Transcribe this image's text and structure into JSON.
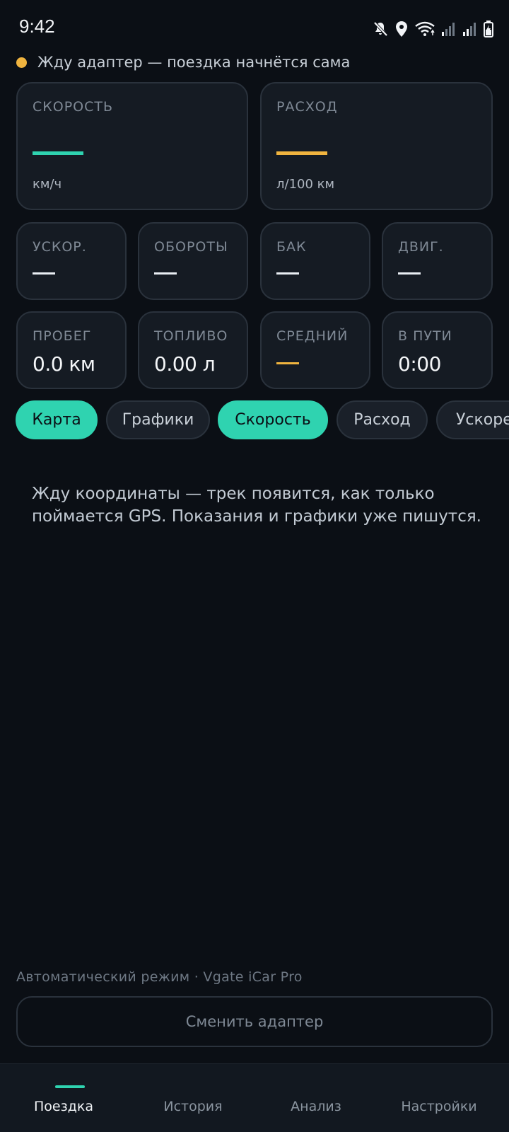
{
  "status_bar": {
    "time": "9:42",
    "icons": [
      "mute-icon",
      "location-icon",
      "wifi-icon",
      "signal-icon",
      "signal-icon",
      "battery-charging-icon"
    ]
  },
  "adapter_status": {
    "text": "Жду адаптер — поездка начнётся сама",
    "dot_color": "#f0b43f"
  },
  "big_cards": [
    {
      "label": "СКОРОСТЬ",
      "unit": "км/ч",
      "accent": "#2fd3b0"
    },
    {
      "label": "РАСХОД",
      "unit": "л/100 км",
      "accent": "#f0b43f"
    }
  ],
  "small_cards_row1": [
    {
      "label": "УСКОР."
    },
    {
      "label": "ОБОРОТЫ"
    },
    {
      "label": "БАК"
    },
    {
      "label": "ДВИГ."
    }
  ],
  "small_cards_row2": [
    {
      "label": "ПРОБЕГ",
      "value": "0.0 км"
    },
    {
      "label": "ТОПЛИВО",
      "value": "0.00 л"
    },
    {
      "label": "СРЕДНИЙ",
      "accent": "#f0b43f"
    },
    {
      "label": "В ПУТИ",
      "value": "0:00"
    }
  ],
  "chips": [
    {
      "label": "Карта",
      "active": true
    },
    {
      "label": "Графики",
      "active": false
    },
    {
      "label": "Скорость",
      "active": true
    },
    {
      "label": "Расход",
      "active": false
    },
    {
      "label": "Ускоре",
      "active": false
    }
  ],
  "message": "Жду координаты — трек появится, как только поймается GPS. Показания и графики уже пишутся.",
  "mode_line": "Автоматический режим · Vgate iCar Pro",
  "change_adapter_label": "Сменить адаптер",
  "bottom_nav": [
    {
      "label": "Поездка",
      "active": true
    },
    {
      "label": "История",
      "active": false
    },
    {
      "label": "Анализ",
      "active": false
    },
    {
      "label": "Настройки",
      "active": false
    }
  ],
  "colors": {
    "accent": "#2fd3b0",
    "warning": "#f0b43f",
    "background": "#0b0f15",
    "card": "#151b23"
  }
}
